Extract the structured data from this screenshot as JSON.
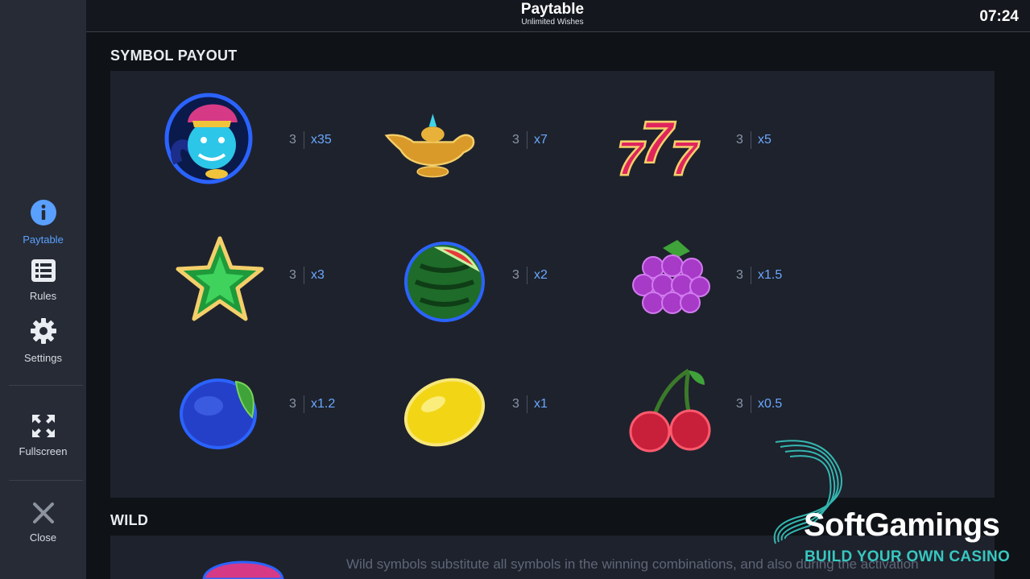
{
  "header": {
    "title": "Paytable",
    "subtitle": "Unlimited Wishes",
    "clock": "07:24"
  },
  "sidebar": {
    "items": [
      {
        "label": "Paytable",
        "icon": "info-icon",
        "active": true
      },
      {
        "label": "Rules",
        "icon": "list-icon",
        "active": false
      },
      {
        "label": "Settings",
        "icon": "gear-icon",
        "active": false
      },
      {
        "label": "Fullscreen",
        "icon": "fullscreen-icon",
        "active": false
      },
      {
        "label": "Close",
        "icon": "close-icon",
        "active": false
      }
    ]
  },
  "sections": {
    "symbol_payout": {
      "title": "SYMBOL PAYOUT"
    },
    "wild": {
      "title": "WILD",
      "text": "Wild symbols substitute all symbols in the winning combinations, and also during the activation"
    }
  },
  "symbols": [
    {
      "name": "genie",
      "count": "3",
      "multiplier": "x35"
    },
    {
      "name": "lamp",
      "count": "3",
      "multiplier": "x7"
    },
    {
      "name": "sevens",
      "count": "3",
      "multiplier": "x5"
    },
    {
      "name": "star",
      "count": "3",
      "multiplier": "x3"
    },
    {
      "name": "watermelon",
      "count": "3",
      "multiplier": "x2"
    },
    {
      "name": "grapes",
      "count": "3",
      "multiplier": "x1.5"
    },
    {
      "name": "plum",
      "count": "3",
      "multiplier": "x1.2"
    },
    {
      "name": "lemon",
      "count": "3",
      "multiplier": "x1"
    },
    {
      "name": "cherry",
      "count": "3",
      "multiplier": "x0.5"
    }
  ],
  "watermark": {
    "name": "SoftGamings",
    "tagline": "BUILD YOUR OWN CASINO"
  },
  "colors": {
    "accent": "#5aa0ff",
    "multiplier": "#6aa8ff",
    "logo_teal": "#37c7c0"
  }
}
